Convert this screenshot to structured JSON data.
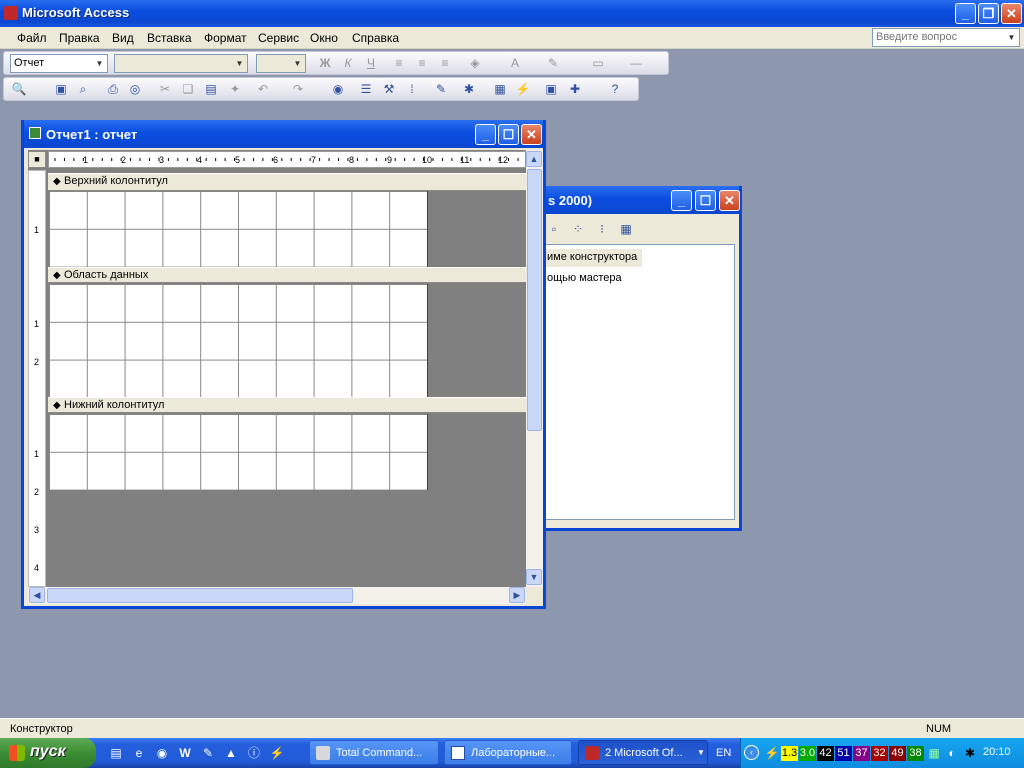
{
  "app": {
    "title": "Microsoft Access"
  },
  "menu": {
    "items": [
      "Файл",
      "Правка",
      "Вид",
      "Вставка",
      "Формат",
      "Сервис",
      "Окно",
      "Справка"
    ],
    "ask_placeholder": "Введите вопрос"
  },
  "toolbar": {
    "object_combo": "Отчет",
    "bold_glyph": "Ж",
    "italic_glyph": "К",
    "underline_glyph": "Ч",
    "font_color_glyph": "А"
  },
  "db_window": {
    "title_partial": "s 2000)",
    "items": [
      "име конструктора",
      "ощью мастера"
    ]
  },
  "report_window": {
    "title": "Отчет1 : отчет",
    "ruler_labels": [
      "1",
      "2",
      "3",
      "4",
      "5",
      "6",
      "7",
      "8",
      "9",
      "10",
      "11",
      "12"
    ],
    "vruler_labels": [
      "1",
      "2",
      "3",
      "4"
    ],
    "sections": {
      "header": "Верхний колонтитул",
      "detail": "Область данных",
      "footer": "Нижний колонтитул"
    }
  },
  "statusbar": {
    "mode": "Конструктор",
    "num": "NUM"
  },
  "taskbar": {
    "start": "пуск",
    "tasks": [
      "Total Command...",
      "Лабораторные...",
      "2 Microsoft Of..."
    ],
    "lang": "EN",
    "tray_numbers": [
      "1.3",
      "3.0",
      "42",
      "51",
      "37",
      "32",
      "49",
      "38"
    ],
    "time": "20:10"
  },
  "colors": {
    "title_blue": "#0a46d6",
    "desktop": "#8d97ad",
    "close_red": "#c9421c",
    "start_green": "#3c8d34"
  }
}
